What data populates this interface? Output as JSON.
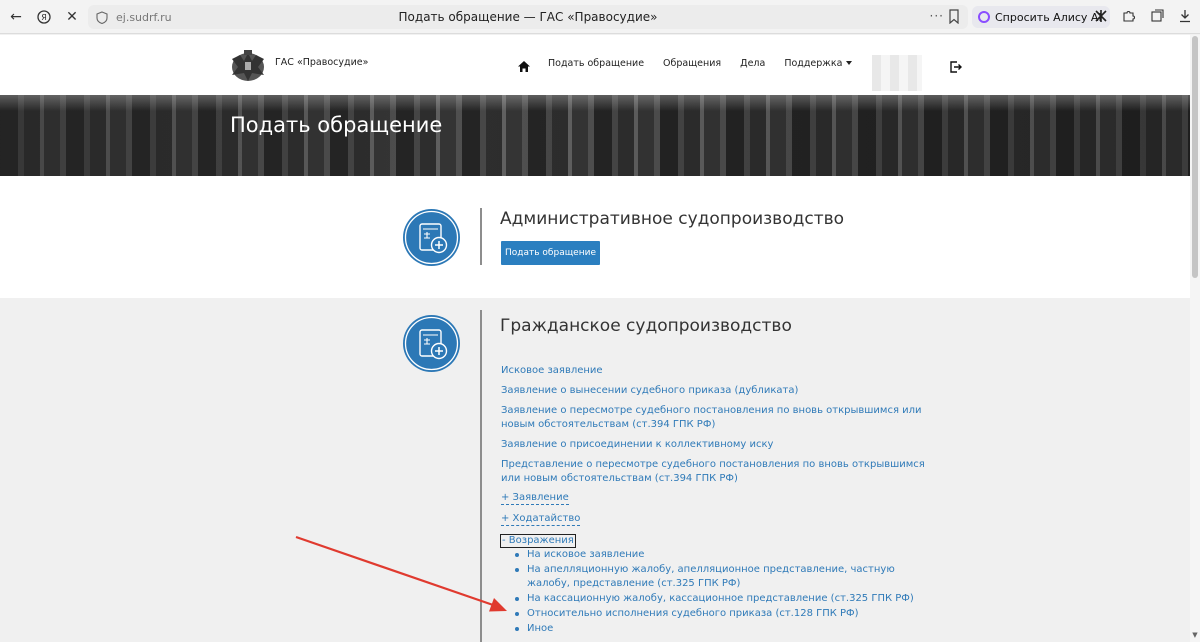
{
  "browser": {
    "url": "ej.sudrf.ru",
    "tab_title": "Подать обращение — ГАС «Правосудие»",
    "alice_label": "Спросить Алису AI"
  },
  "header": {
    "brand": "ГАС «Правосудие»",
    "menu": {
      "submit": "Подать обращение",
      "appeals": "Обращения",
      "cases": "Дела",
      "support": "Поддержка"
    }
  },
  "banner": {
    "title": "Подать обращение"
  },
  "admin": {
    "title": "Административное судопроизводство",
    "button": "Подать обращение"
  },
  "civil": {
    "title": "Гражданское судопроизводство",
    "links": [
      "Исковое заявление",
      "Заявление о вынесении судебного приказа (дубликата)",
      "Заявление о пересмотре судебного постановления по вновь открывшимся или новым обстоятельствам (ст.394 ГПК РФ)",
      "Заявление о присоединении к коллективному иску",
      "Представление о пересмотре судебного постановления по вновь открывшимся или новым обстоятельствам (ст.394 ГПК РФ)"
    ],
    "toggles": {
      "statement": "+ Заявление",
      "petition": "+ Ходатайство",
      "objection": "- Возражения"
    },
    "objection_items": [
      "На исковое заявление",
      "На апелляционную жалобу, апелляционное представление, частную жалобу, представление (ст.325 ГПК РФ)",
      "На кассационную жалобу, кассационное представление (ст.325 ГПК РФ)",
      "Относительно исполнения судебного приказа (ст.128 ГПК РФ)",
      "Иное"
    ]
  },
  "colors": {
    "accent": "#2c78b6",
    "link": "#2f7ab8",
    "annotation": "#e03a2f"
  }
}
